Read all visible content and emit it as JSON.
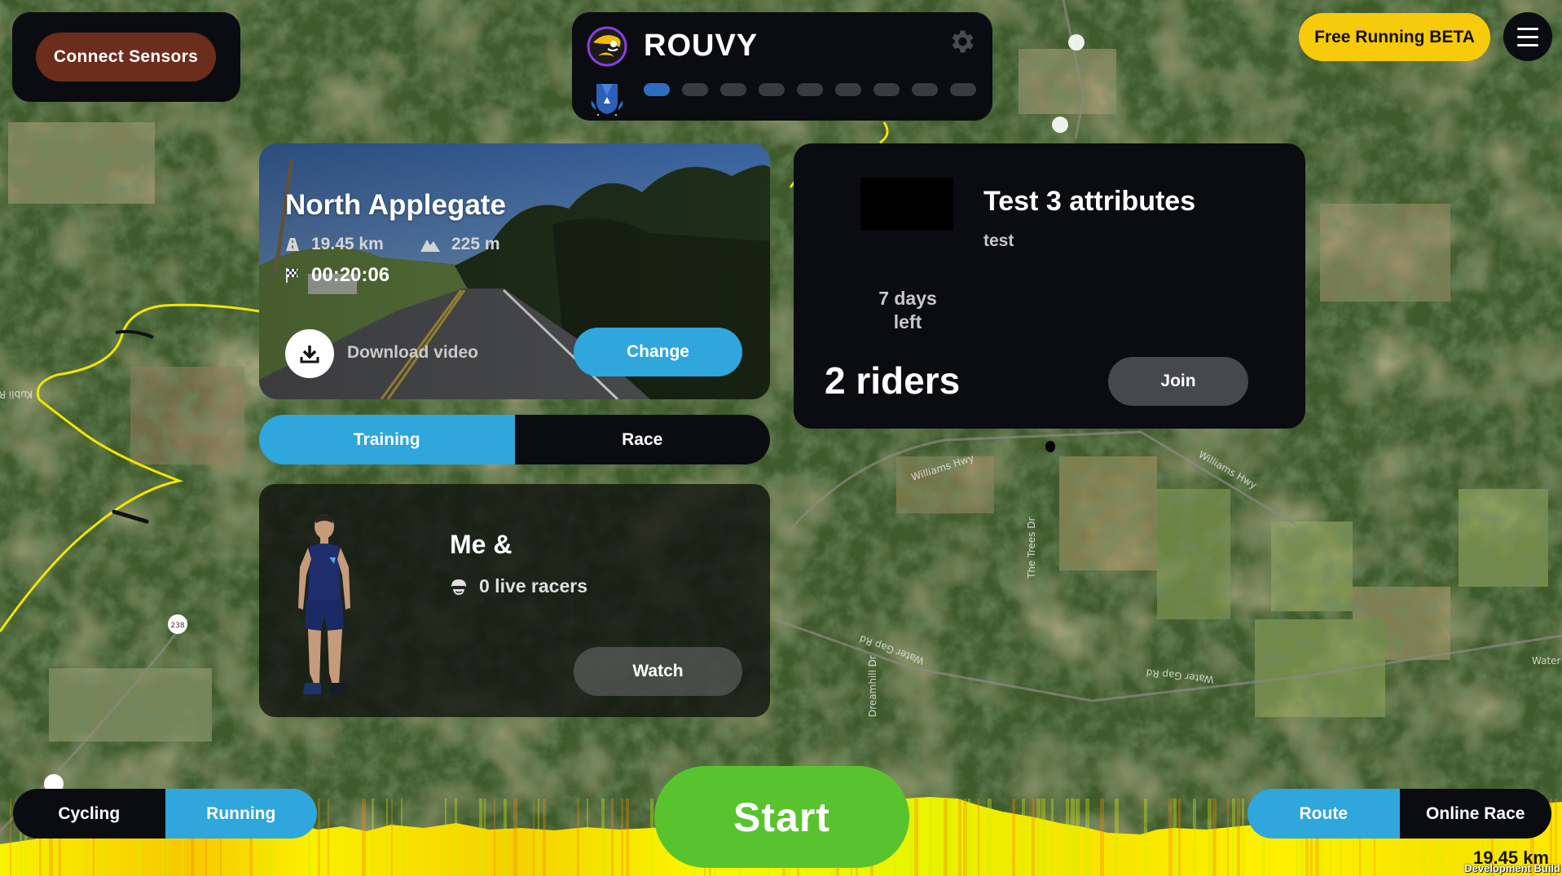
{
  "app": {
    "title": "ROUVY",
    "progress": {
      "total_steps": 9,
      "current_step": 1
    }
  },
  "colors": {
    "accent_blue": "#2fa6dc",
    "start_green": "#59c32f",
    "beta_yellow": "#f7ca0b",
    "sensors_brown": "#6b2d1c",
    "panel_dark": "#0b0c11",
    "route_yellow": "#f5e600"
  },
  "header": {
    "connect_sensors_label": "Connect Sensors",
    "beta_label": "Free Running BETA",
    "icons": {
      "logo": "rouvy-bird-logo",
      "settings": "gear-icon",
      "badge": "shield-badge-icon",
      "menu": "hamburger-menu-icon"
    }
  },
  "route": {
    "name": "North Applegate",
    "distance": "19.45 km",
    "elevation": "225 m",
    "duration": "00:20:06",
    "download_label": "Download video",
    "change_label": "Change",
    "icons": {
      "distance": "road-icon",
      "elevation": "mountain-icon",
      "time": "checkered-flag-icon",
      "download": "download-icon"
    }
  },
  "mode_tabs": [
    {
      "label": "Training",
      "active": true
    },
    {
      "label": "Race",
      "active": false
    }
  ],
  "me_card": {
    "title": "Me &",
    "live_racers": "0 live racers",
    "watch_label": "Watch",
    "icons": {
      "racers": "helmet-rider-icon"
    }
  },
  "challenge": {
    "title": "Test 3 attributes",
    "subtitle": "test",
    "days_left_line1": "7 days",
    "days_left_line2": "left",
    "riders": "2 riders",
    "join_label": "Join"
  },
  "sport_tabs": [
    {
      "label": "Cycling",
      "active": false
    },
    {
      "label": "Running",
      "active": true
    }
  ],
  "type_tabs": [
    {
      "label": "Route",
      "active": true
    },
    {
      "label": "Online Race",
      "active": false
    }
  ],
  "start_label": "Start",
  "profile": {
    "total_distance": "19.45 km",
    "build_label": "Development Build"
  },
  "map_labels": [
    "Williams Hwy",
    "Williams Hwy",
    "The Trees Dr",
    "Water Gap Rd",
    "Water Gap Rd",
    "Dreamhill Dr",
    "Water",
    "Kubli Rd",
    "238"
  ]
}
